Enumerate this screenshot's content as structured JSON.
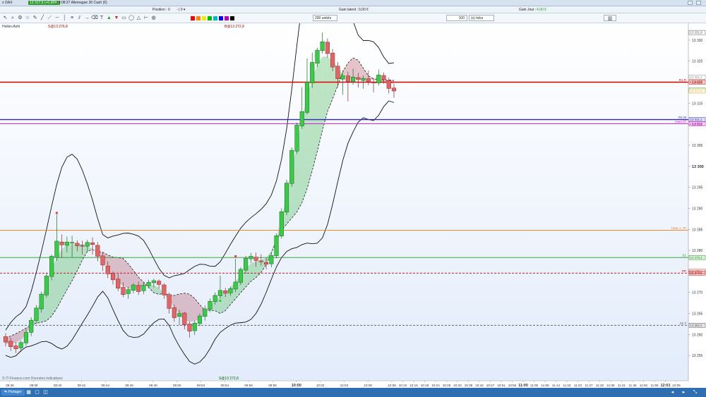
{
  "titlebar": {
    "menu": "≡ DAX",
    "price_badge": "13 317,9 (+0,96%)",
    "title": "10:08:27 Allemagne 30 Cash (€)"
  },
  "infobar": {
    "position_label": "Position :",
    "position_value": "0",
    "position_ctrl": "- | 0 ▾",
    "gain_latent_label": "Gain latent :",
    "gain_latent_value": "0,00 €",
    "gain_jour_label": "Gain Jour :",
    "gain_jour_value": "4,00 €"
  },
  "toolbar": {
    "units_select": "200 unités",
    "ticks_value": "100",
    "ticks_unit": "(x) ticks",
    "icons": [
      "cursor-icon",
      "zoom-icon",
      "gear-icon",
      "star-icon",
      "pencil-icon",
      "line-icon",
      "ray-icon",
      "hline-icon",
      "vline-icon",
      "fib-icon",
      "channel-icon",
      "arrow-icon",
      "trash-icon",
      "text-icon",
      "buy-icon",
      "sell-icon",
      "rect-icon",
      "ellipse-icon",
      "triangle-icon",
      "measure-icon",
      "palette-icon"
    ]
  },
  "chart_labels": {
    "top_left_label": "Heikin-Ashi",
    "order_label_1": "S@13 276,8",
    "order_label_2": "B@13 272,8",
    "order_label_3": "S@13 272,8",
    "watermark": "© IT-Finance.com Données indicatives"
  },
  "colors": {
    "up": "#3cc84a",
    "down": "#e06666",
    "r1": "#e00000",
    "s1": "#1f9a1f",
    "pivot_blue": "#2b2bb8",
    "magenta": "#e000e0",
    "orange": "#f07a1a",
    "bg_top": "#ffffff",
    "bg_bottom": "#e3ecfb"
  },
  "chart_data": {
    "type": "candlestick",
    "ylim": [
      13249,
      13334
    ],
    "y_ticks": [
      13330,
      13325,
      13320,
      13315,
      13310,
      13305,
      13300,
      13295,
      13290,
      13285,
      13280,
      13275,
      13270,
      13265,
      13260,
      13255
    ],
    "x_ticks": [
      "09:36",
      "09:38",
      "09:40",
      "09:42",
      "09:44",
      "09:46",
      "09:48",
      "09:50",
      "09:52",
      "09:54",
      "09:56",
      "09:58",
      "10:00",
      "10:02",
      "10:04",
      "10:06",
      "10:08",
      "10:10",
      "10:15",
      "10:19",
      "10:24",
      "10:28",
      "10:33",
      "10:38",
      "10:42",
      "10:47",
      "10:51",
      "10:56",
      "11:00",
      "11:05",
      "11:09",
      "11:14",
      "11:18",
      "11:23",
      "11:27",
      "11:32",
      "11:36",
      "11:41",
      "11:46",
      "11:50",
      "11:55",
      "12:01",
      "12:05"
    ],
    "bold_ticks": [
      "10:00",
      "11:00",
      "12:01"
    ],
    "candles": [
      {
        "t": "09:35",
        "o": 13259.5,
        "h": 13260.3,
        "l": 13257.2,
        "c": 13258.2
      },
      {
        "t": "09:35",
        "o": 13258.4,
        "h": 13259.2,
        "l": 13256.1,
        "c": 13257.1
      },
      {
        "t": "09:35",
        "o": 13257.3,
        "h": 13258.2,
        "l": 13255.6,
        "c": 13256.6
      },
      {
        "t": "09:36",
        "o": 13256.8,
        "h": 13258.5,
        "l": 13255.8,
        "c": 13258.1
      },
      {
        "t": "09:36",
        "o": 13258.0,
        "h": 13261.2,
        "l": 13257.3,
        "c": 13260.5
      },
      {
        "t": "09:37",
        "o": 13260.5,
        "h": 13264.1,
        "l": 13259.6,
        "c": 13263.4
      },
      {
        "t": "09:37",
        "o": 13263.3,
        "h": 13267.0,
        "l": 13262.6,
        "c": 13266.3
      },
      {
        "t": "09:38",
        "o": 13266.1,
        "h": 13270.2,
        "l": 13265.2,
        "c": 13269.6
      },
      {
        "t": "09:39",
        "o": 13269.4,
        "h": 13274.7,
        "l": 13268.8,
        "c": 13273.9
      },
      {
        "t": "09:39",
        "o": 13273.8,
        "h": 13279.0,
        "l": 13272.9,
        "c": 13278.6
      },
      {
        "t": "09:40",
        "o": 13278.3,
        "h": 13288.5,
        "l": 13277.5,
        "c": 13282.2
      },
      {
        "t": "09:40",
        "o": 13282.0,
        "h": 13283.8,
        "l": 13278.2,
        "c": 13281.3
      },
      {
        "t": "09:41",
        "o": 13281.2,
        "h": 13283.3,
        "l": 13279.5,
        "c": 13282.0
      },
      {
        "t": "09:41",
        "o": 13281.8,
        "h": 13283.5,
        "l": 13278.4,
        "c": 13281.9
      },
      {
        "t": "09:41",
        "o": 13281.7,
        "h": 13282.4,
        "l": 13279.8,
        "c": 13281.1
      },
      {
        "t": "09:42",
        "o": 13281.2,
        "h": 13282.3,
        "l": 13279.0,
        "c": 13281.0
      },
      {
        "t": "09:42",
        "o": 13281.0,
        "h": 13282.5,
        "l": 13279.6,
        "c": 13281.9
      },
      {
        "t": "09:42",
        "o": 13281.8,
        "h": 13283.1,
        "l": 13279.0,
        "c": 13281.4
      },
      {
        "t": "09:43",
        "o": 13281.2,
        "h": 13282.0,
        "l": 13277.4,
        "c": 13278.6
      },
      {
        "t": "09:43",
        "o": 13278.7,
        "h": 13279.6,
        "l": 13275.1,
        "c": 13276.5
      },
      {
        "t": "09:43",
        "o": 13276.3,
        "h": 13277.4,
        "l": 13273.4,
        "c": 13274.4
      },
      {
        "t": "09:44",
        "o": 13274.6,
        "h": 13275.0,
        "l": 13271.9,
        "c": 13273.0
      },
      {
        "t": "09:44",
        "o": 13273.2,
        "h": 13274.4,
        "l": 13270.3,
        "c": 13271.0
      },
      {
        "t": "09:45",
        "o": 13271.2,
        "h": 13272.4,
        "l": 13268.9,
        "c": 13269.5
      },
      {
        "t": "09:45",
        "o": 13269.7,
        "h": 13271.4,
        "l": 13268.5,
        "c": 13270.7
      },
      {
        "t": "09:46",
        "o": 13270.5,
        "h": 13272.2,
        "l": 13269.8,
        "c": 13271.8
      },
      {
        "t": "09:46",
        "o": 13271.7,
        "h": 13272.6,
        "l": 13269.4,
        "c": 13270.2
      },
      {
        "t": "09:47",
        "o": 13270.4,
        "h": 13272.4,
        "l": 13269.6,
        "c": 13271.7
      },
      {
        "t": "09:47",
        "o": 13271.6,
        "h": 13273.0,
        "l": 13271.0,
        "c": 13272.4
      },
      {
        "t": "09:48",
        "o": 13272.3,
        "h": 13273.3,
        "l": 13271.2,
        "c": 13272.8
      },
      {
        "t": "09:48",
        "o": 13272.7,
        "h": 13273.1,
        "l": 13270.9,
        "c": 13271.9
      },
      {
        "t": "09:49",
        "o": 13271.8,
        "h": 13272.2,
        "l": 13268.5,
        "c": 13269.4
      },
      {
        "t": "09:50",
        "o": 13269.5,
        "h": 13270.0,
        "l": 13265.0,
        "c": 13266.2
      },
      {
        "t": "09:50",
        "o": 13266.4,
        "h": 13267.1,
        "l": 13263.0,
        "c": 13264.0
      },
      {
        "t": "09:51",
        "o": 13264.3,
        "h": 13265.9,
        "l": 13262.2,
        "c": 13265.0
      },
      {
        "t": "09:52",
        "o": 13265.1,
        "h": 13265.4,
        "l": 13261.2,
        "c": 13262.3
      },
      {
        "t": "09:52",
        "o": 13262.5,
        "h": 13263.1,
        "l": 13259.3,
        "c": 13260.8
      },
      {
        "t": "09:53",
        "o": 13260.9,
        "h": 13263.3,
        "l": 13259.9,
        "c": 13262.7
      },
      {
        "t": "09:53",
        "o": 13262.6,
        "h": 13265.0,
        "l": 13262.0,
        "c": 13264.4
      },
      {
        "t": "09:54",
        "o": 13264.3,
        "h": 13266.9,
        "l": 13263.3,
        "c": 13266.1
      },
      {
        "t": "09:54",
        "o": 13266.0,
        "h": 13268.6,
        "l": 13265.3,
        "c": 13267.9
      },
      {
        "t": "09:55",
        "o": 13267.8,
        "h": 13270.0,
        "l": 13267.1,
        "c": 13269.3
      },
      {
        "t": "09:56",
        "o": 13269.2,
        "h": 13274.0,
        "l": 13268.6,
        "c": 13270.5
      },
      {
        "t": "09:56",
        "o": 13270.4,
        "h": 13271.1,
        "l": 13268.9,
        "c": 13269.8
      },
      {
        "t": "09:57",
        "o": 13269.9,
        "h": 13271.4,
        "l": 13269.2,
        "c": 13270.9
      },
      {
        "t": "09:57",
        "o": 13270.8,
        "h": 13278.0,
        "l": 13270.1,
        "c": 13272.5
      },
      {
        "t": "09:58",
        "o": 13272.4,
        "h": 13276.0,
        "l": 13271.8,
        "c": 13275.5
      },
      {
        "t": "09:59",
        "o": 13275.3,
        "h": 13278.7,
        "l": 13274.5,
        "c": 13278.1
      },
      {
        "t": "09:59",
        "o": 13278.0,
        "h": 13279.4,
        "l": 13277.0,
        "c": 13278.6
      },
      {
        "t": "10:00",
        "o": 13278.4,
        "h": 13279.5,
        "l": 13276.1,
        "c": 13277.6
      },
      {
        "t": "10:00",
        "o": 13277.5,
        "h": 13279.1,
        "l": 13276.4,
        "c": 13277.3
      },
      {
        "t": "10:01",
        "o": 13277.1,
        "h": 13278.2,
        "l": 13275.5,
        "c": 13276.7
      },
      {
        "t": "10:01",
        "o": 13276.8,
        "h": 13279.4,
        "l": 13276.0,
        "c": 13278.8
      },
      {
        "t": "10:02",
        "o": 13278.7,
        "h": 13284.0,
        "l": 13278.1,
        "c": 13283.5
      },
      {
        "t": "10:02",
        "o": 13283.4,
        "h": 13290.0,
        "l": 13282.8,
        "c": 13289.2
      },
      {
        "t": "10:03",
        "o": 13289.1,
        "h": 13296.8,
        "l": 13288.4,
        "c": 13296.0
      },
      {
        "t": "10:03",
        "o": 13295.9,
        "h": 13304.5,
        "l": 13295.1,
        "c": 13303.8
      },
      {
        "t": "10:04",
        "o": 13303.6,
        "h": 13310.4,
        "l": 13302.9,
        "c": 13309.8
      },
      {
        "t": "10:04",
        "o": 13309.6,
        "h": 13318.8,
        "l": 13308.9,
        "c": 13313.0
      },
      {
        "t": "10:05",
        "o": 13312.8,
        "h": 13325.6,
        "l": 13312.3,
        "c": 13320.0
      },
      {
        "t": "10:05",
        "o": 13319.8,
        "h": 13327.0,
        "l": 13318.6,
        "c": 13324.7
      },
      {
        "t": "10:06",
        "o": 13324.5,
        "h": 13328.2,
        "l": 13323.6,
        "c": 13327.6
      },
      {
        "t": "10:06",
        "o": 13327.5,
        "h": 13331.8,
        "l": 13326.8,
        "c": 13329.6
      },
      {
        "t": "10:06",
        "o": 13329.5,
        "h": 13330.4,
        "l": 13325.8,
        "c": 13326.8
      },
      {
        "t": "10:07",
        "o": 13326.9,
        "h": 13327.9,
        "l": 13322.6,
        "c": 13323.6
      },
      {
        "t": "10:07",
        "o": 13323.8,
        "h": 13324.8,
        "l": 13318.8,
        "c": 13320.8
      },
      {
        "t": "10:07",
        "o": 13320.7,
        "h": 13322.8,
        "l": 13317.0,
        "c": 13321.6
      },
      {
        "t": "10:07",
        "o": 13321.5,
        "h": 13322.5,
        "l": 13315.4,
        "c": 13320.2
      },
      {
        "t": "10:07",
        "o": 13320.1,
        "h": 13323.2,
        "l": 13319.4,
        "c": 13321.2
      },
      {
        "t": "10:07",
        "o": 13321.1,
        "h": 13322.2,
        "l": 13318.7,
        "c": 13320.6
      },
      {
        "t": "10:08",
        "o": 13320.4,
        "h": 13321.6,
        "l": 13318.4,
        "c": 13320.9
      },
      {
        "t": "10:08",
        "o": 13320.8,
        "h": 13322.8,
        "l": 13319.3,
        "c": 13320.1
      },
      {
        "t": "10:08",
        "o": 13320.0,
        "h": 13321.0,
        "l": 13317.6,
        "c": 13319.8
      },
      {
        "t": "10:08",
        "o": 13319.8,
        "h": 13323.0,
        "l": 13319.2,
        "c": 13321.7
      },
      {
        "t": "10:08",
        "o": 13321.6,
        "h": 13322.3,
        "l": 13319.6,
        "c": 13320.6
      },
      {
        "t": "10:08",
        "o": 13320.4,
        "h": 13321.1,
        "l": 13317.3,
        "c": 13318.5
      },
      {
        "t": "10:08",
        "o": 13318.6,
        "h": 13319.6,
        "l": 13316.3,
        "c": 13317.9
      }
    ],
    "sar_levels": [
      {
        "name": "R1",
        "value": 13320.0,
        "label": "R1 R",
        "price_tag": "13 320,0"
      },
      {
        "name": "R1 M",
        "value": 13311.1,
        "label": "R1 M",
        "price_tag": "13 311,1"
      },
      {
        "name": "Haut m",
        "value": 13310.1,
        "label": "Haut ////",
        "price_tag": "13 310,1"
      },
      {
        "name": "Haut J",
        "value": 13284.8,
        "label": "Haut J,, Pr"
      },
      {
        "name": "S1",
        "value": 13278.3,
        "label": "S1",
        "price_tag": "13 278,3"
      },
      {
        "name": "PP",
        "value": 13274.6,
        "label": "PP",
        "price_tag": "13 274,6"
      },
      {
        "name": "S2",
        "value": 13262.2,
        "label": "S2 //",
        "price_tag": "13 262,2"
      }
    ],
    "right_tags": {
      "last_price": "13 317,9",
      "high_tag": "13 331,8",
      "r1_upper": "13 321,2",
      "current_a": "13 318,1",
      "current_b": "13 317,9",
      "pivot_tag": "13 275,0"
    }
  }
}
